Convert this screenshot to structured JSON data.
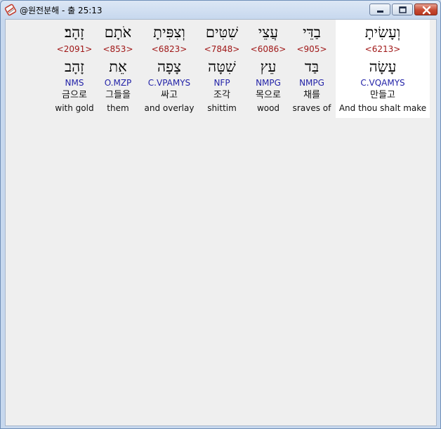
{
  "window": {
    "title": "@원전분해 - 출 25:13"
  },
  "verse": {
    "words": [
      {
        "hebrew": "וְעָשִׂיתָ",
        "strong": "<6213>",
        "lemma": "עָשָׂה",
        "morph": "C.VQAMYS",
        "korean": "만들고",
        "english": "And thou shalt make"
      },
      {
        "hebrew": "בַדֵּי",
        "strong": "<905>",
        "lemma": "בַּד",
        "morph": "NMPG",
        "korean": "채를",
        "english": "sraves of"
      },
      {
        "hebrew": "עֲצֵי",
        "strong": "<6086>",
        "lemma": "עֵץ",
        "morph": "NMPG",
        "korean": "목으로",
        "english": "wood"
      },
      {
        "hebrew": "שִׁטִּים",
        "strong": "<7848>",
        "lemma": "שִׁטָּה",
        "morph": "NFP",
        "korean": "조각",
        "english": "shittim"
      },
      {
        "hebrew": "וְצִפִּיתָ",
        "strong": "<6823>",
        "lemma": "צָפָה",
        "morph": "C.VPAMYS",
        "korean": "싸고",
        "english": "and overlay"
      },
      {
        "hebrew": "אֹתָם",
        "strong": "<853>",
        "lemma": "אֵת",
        "morph": "O.MZP",
        "korean": "그들을",
        "english": "them"
      },
      {
        "hebrew": "זָהָב׃",
        "strong": "<2091>",
        "lemma": "זָהָב",
        "morph": "NMS",
        "korean": "금으로",
        "english": "with gold"
      }
    ]
  },
  "colors": {
    "strong": "#a01818",
    "morph": "#2323a8",
    "text": "#111111",
    "client_bg": "#efefef",
    "highlight_bg": "#ffffff"
  }
}
